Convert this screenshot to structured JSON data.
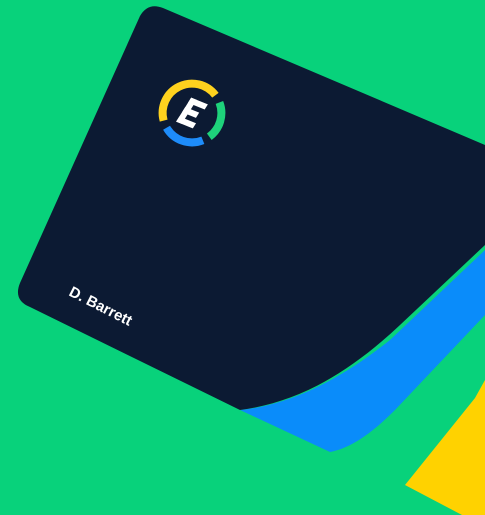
{
  "card": {
    "holder_name": "D. Barrett"
  },
  "logo": {
    "letter": "E",
    "icon": "circular-e-logo-icon"
  },
  "colors": {
    "background": "#08D27B",
    "card": "#0C1A33",
    "card_back": "#0A8CFA",
    "accent_yellow": "#FFD200",
    "logo_yellow": "#FFD21E",
    "logo_green": "#1ED27B",
    "logo_blue": "#1E8CFA",
    "text": "#FFFFFF"
  }
}
